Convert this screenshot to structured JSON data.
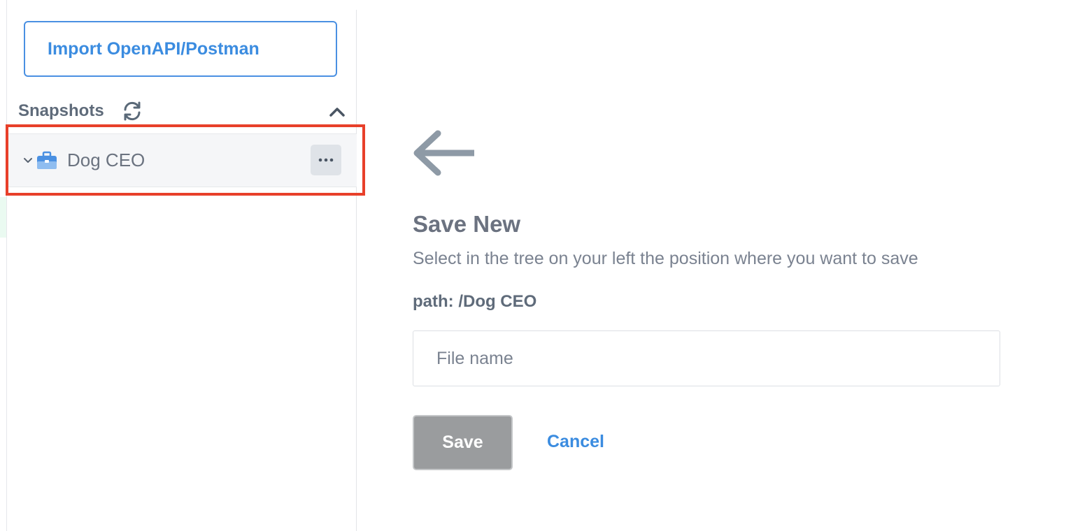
{
  "sidebar": {
    "import_label": "Import OpenAPI/Postman",
    "snapshots_title": "Snapshots",
    "tree": [
      {
        "label": "Dog CEO",
        "icon": "briefcase-icon",
        "expanded": false
      }
    ]
  },
  "form": {
    "title": "Save New",
    "description": "Select in the tree on your left the position where you want to save",
    "path": "path: /Dog CEO",
    "file_placeholder": "File name",
    "file_value": "",
    "save_label": "Save",
    "cancel_label": "Cancel"
  },
  "colors": {
    "accent": "#3b8ce0",
    "highlight": "#e8402a",
    "save_disabled": "#9a9c9e"
  }
}
